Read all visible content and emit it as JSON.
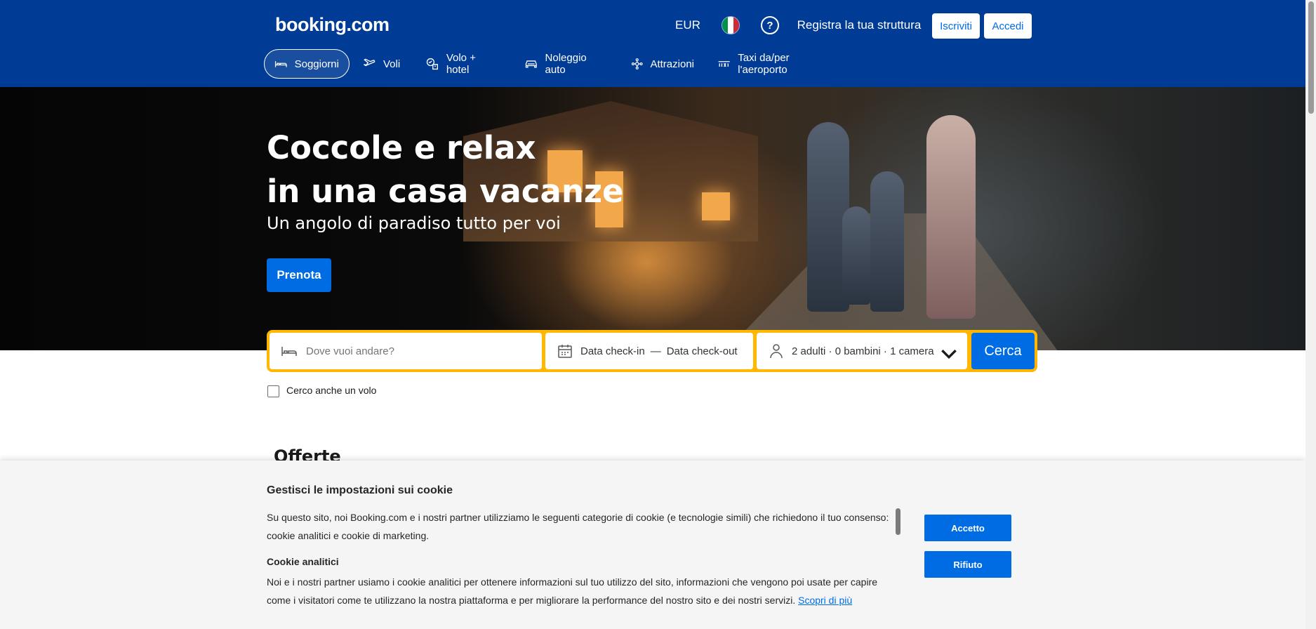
{
  "header": {
    "logo": "booking.com",
    "currency": "EUR",
    "register_property": "Registra la tua struttura",
    "signup": "Iscriviti",
    "login": "Accedi",
    "flag_colors": [
      "#009246",
      "#ffffff",
      "#ce2b37"
    ]
  },
  "nav": [
    {
      "label": "Soggiorni",
      "icon": "bed-icon",
      "active": true
    },
    {
      "label": "Voli",
      "icon": "plane-icon",
      "active": false
    },
    {
      "label": "Volo + hotel",
      "icon": "plane-hotel-icon",
      "active": false
    },
    {
      "label": "Noleggio auto",
      "icon": "car-icon",
      "active": false
    },
    {
      "label": "Attrazioni",
      "icon": "attractions-icon",
      "active": false
    },
    {
      "label": "Taxi da/per l'aeroporto",
      "icon": "taxi-icon",
      "active": false
    }
  ],
  "hero": {
    "title_line1": "Coccole e relax",
    "title_line2": "in una casa vacanze",
    "subtitle": "Un angolo di paradiso tutto per voi",
    "cta": "Prenota"
  },
  "search": {
    "destination_placeholder": "Dove vuoi andare?",
    "checkin": "Data check-in",
    "separator": "—",
    "checkout": "Data check-out",
    "guests": "2 adulti · 0 bambini · 1 camera",
    "submit": "Cerca",
    "flight_checkbox_label": "Cerco anche un volo"
  },
  "section": {
    "offers_title": "Offerte"
  },
  "cookie": {
    "title": "Gestisci le impostazioni sui cookie",
    "intro": "Su questo sito, noi Booking.com e i nostri partner utilizziamo le seguenti categorie di cookie (e tecnologie simili) che richiedono il tuo consenso: cookie analitici e cookie di marketing.",
    "analytics_title": "Cookie analitici",
    "analytics_text": "Noi e i nostri partner usiamo i cookie analitici per ottenere informazioni sul tuo utilizzo del sito, informazioni che vengono poi usate per capire come i visitatori come te utilizzano la nostra piattaforma e per migliorare la performance del nostro sito e dei nostri servizi.",
    "more_link": "Scopri di più",
    "accept": "Accetto",
    "reject": "Rifiuto"
  },
  "colors": {
    "brand_blue": "#003b95",
    "action_blue": "#006ce4",
    "search_border": "#ffb700"
  }
}
